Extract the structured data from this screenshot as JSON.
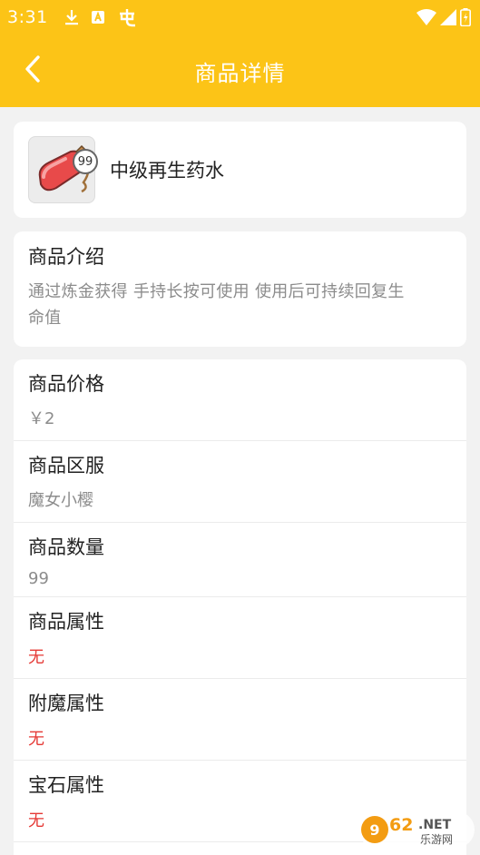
{
  "status_bar": {
    "time": "3:31",
    "left_icons": [
      "download-icon",
      "a-icon",
      "bug-icon"
    ],
    "right_icons": [
      "wifi-icon",
      "cell-signal-icon",
      "battery-icon"
    ]
  },
  "header": {
    "title": "商品详情",
    "back_icon": "chevron-left-icon",
    "background_color": "#fcc417"
  },
  "item": {
    "name": "中级再生药水",
    "badge": "99",
    "icon": "potion-icon"
  },
  "intro": {
    "title": "商品介绍",
    "lines": [
      "通过炼金获得 手持长按可使用 使用后可持续回复生",
      "命值"
    ]
  },
  "details": [
    {
      "label": "商品价格",
      "value": "￥2",
      "value_color": "#8c8c8c"
    },
    {
      "label": "商品区服",
      "value": "魔女小樱",
      "value_color": "#8c8c8c"
    },
    {
      "label": "商品数量",
      "value": "99",
      "value_color": "#8c8c8c"
    },
    {
      "label": "商品属性",
      "value": "无",
      "value_color": "#e53935"
    },
    {
      "label": "附魔属性",
      "value": "无",
      "value_color": "#e53935"
    },
    {
      "label": "宝石属性",
      "value": "无",
      "value_color": "#e53935"
    }
  ],
  "watermark": {
    "brand": "962",
    "suffix": ".NET",
    "subtitle": "乐游网"
  }
}
